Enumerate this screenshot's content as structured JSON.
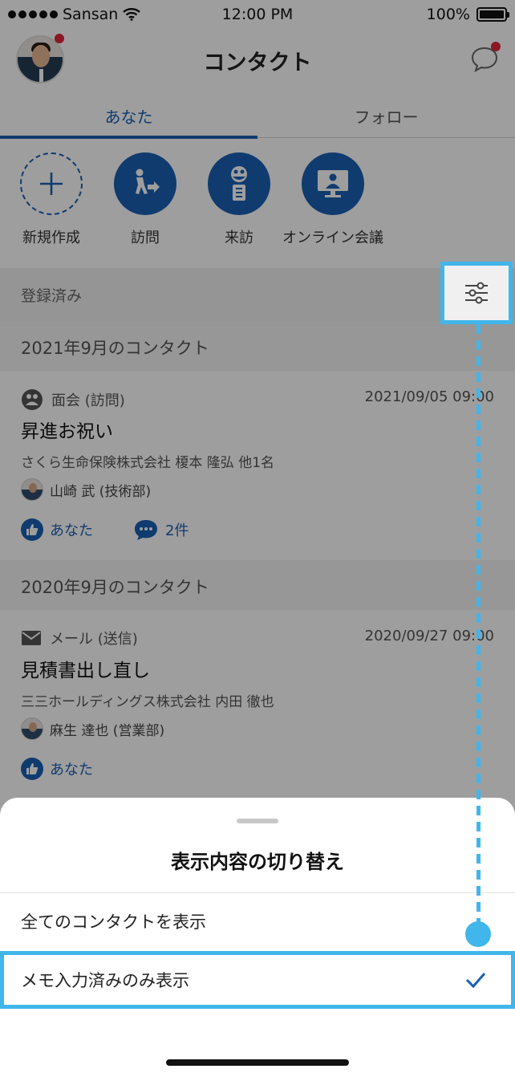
{
  "status_bar": {
    "carrier": "Sansan",
    "time": "12:00 PM",
    "battery": "100%"
  },
  "header": {
    "title": "コンタクト"
  },
  "tabs": [
    {
      "label": "あなた",
      "active": true
    },
    {
      "label": "フォロー",
      "active": false
    }
  ],
  "quick_actions": [
    {
      "label": "新規作成",
      "icon": "plus-icon"
    },
    {
      "label": "訪問",
      "icon": "walk-icon"
    },
    {
      "label": "来訪",
      "icon": "visitor-icon"
    },
    {
      "label": "オンライン会議",
      "icon": "monitor-icon"
    }
  ],
  "registered_bar": {
    "label": "登録済み",
    "icon": "filter-sliders-icon"
  },
  "sections": [
    {
      "month": "2021年9月のコンタクト",
      "card": {
        "type": "面会 (訪問)",
        "date": "2021/09/05 09:00",
        "title": "昇進お祝い",
        "company": "さくら生命保険株式会社 榎本 隆弘 他1名",
        "user": "山崎 武 (技術部)",
        "like_label": "あなた",
        "comment_label": "2件"
      }
    },
    {
      "month": "2020年9月のコンタクト",
      "card": {
        "type": "メール (送信)",
        "date": "2020/09/27 09:00",
        "title": "見積書出し直し",
        "company": "三三ホールディングス株式会社 内田 徹也",
        "user": "麻生 達也 (営業部)",
        "like_label": "あなた"
      }
    }
  ],
  "sheet": {
    "title": "表示内容の切り替え",
    "options": [
      {
        "label": "全てのコンタクトを表示",
        "selected": false
      },
      {
        "label": "メモ入力済みのみ表示",
        "selected": true
      }
    ]
  },
  "colors": {
    "accent": "#1a5fb4",
    "highlight": "#40b6ea"
  }
}
